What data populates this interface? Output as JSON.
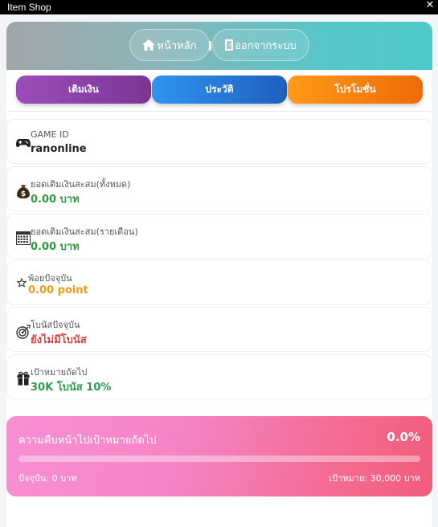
{
  "window": {
    "title": "Item Shop",
    "close_glyph": "✕"
  },
  "nav": {
    "home_label": "หน้าหลัก",
    "logout_label": "ออกจากระบบ",
    "separator": "|"
  },
  "tabs": [
    {
      "label": "เติมเงิน",
      "color": "#8e44ad"
    },
    {
      "label": "ประวัติ",
      "color": "#2a7fdc"
    },
    {
      "label": "โปรโมชั่น",
      "color": "#f77d0d"
    }
  ],
  "cards": {
    "game_id": {
      "icon": "gamepad-icon",
      "label": "GAME ID",
      "value": "ranonline",
      "color": "#222222"
    },
    "total_topup": {
      "icon": "money-bag-icon",
      "label": "ยอดเติมเงินสะสม(ทั้งหมด)",
      "value": "0.00 บาท",
      "color": "#2e9a3a"
    },
    "monthly_topup": {
      "icon": "calendar-icon",
      "label": "ยอดเติมเงินสะสม(รายเดือน)",
      "value": "0.00 บาท",
      "color": "#2e9a3a"
    },
    "points": {
      "icon": "star-icon",
      "label": "พ้อยปัจจุบัน",
      "value": "0.00 point",
      "color": "#f39c12"
    },
    "bonus": {
      "icon": "target-icon",
      "label": "โบนัสปัจจุบัน",
      "value": "ยังไม่มีโบนัส",
      "color": "#e03c3c"
    },
    "next_goal": {
      "icon": "gift-icon",
      "label": "เป้าหมายถัดไป",
      "value": "30K โบนัส 10%",
      "color": "#2e9a55"
    }
  },
  "progress": {
    "title": "ความคืบหน้าไปเป้าหมายถัดไป",
    "percent_text": "0.0%",
    "fraction": 0.0,
    "current_text": "ปัจจุบัน: 0 บาท",
    "goal_text": "เป้าหมาย: 30,000 บาท"
  }
}
